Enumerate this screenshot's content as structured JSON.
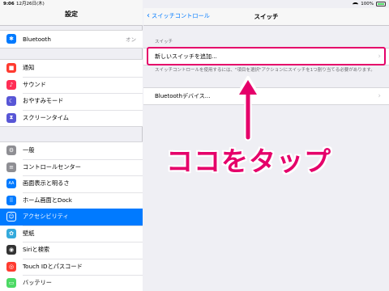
{
  "status": {
    "time": "9:06",
    "date": "12月26日(木)",
    "battery": "100%"
  },
  "sidebar": {
    "title": "設定",
    "bluetooth": {
      "label": "Bluetooth",
      "value": "オン"
    },
    "group2": [
      {
        "label": "通知",
        "icon": "notifications-icon",
        "color": "#ff3b30"
      },
      {
        "label": "サウンド",
        "icon": "sound-icon",
        "color": "#ff2d55"
      },
      {
        "label": "おやすみモード",
        "icon": "moon-icon",
        "color": "#5856d6"
      },
      {
        "label": "スクリーンタイム",
        "icon": "hourglass-icon",
        "color": "#5856d6"
      }
    ],
    "group3": [
      {
        "label": "一般",
        "icon": "gear-icon",
        "color": "#8e8e93"
      },
      {
        "label": "コントロールセンター",
        "icon": "switches-icon",
        "color": "#8e8e93"
      },
      {
        "label": "画面表示と明るさ",
        "icon": "display-icon",
        "color": "#007aff"
      },
      {
        "label": "ホーム画面とDock",
        "icon": "grid-icon",
        "color": "#007aff"
      },
      {
        "label": "アクセシビリティ",
        "icon": "accessibility-icon",
        "color": "#007aff",
        "selected": true
      },
      {
        "label": "壁紙",
        "icon": "wallpaper-icon",
        "color": "#34aadc"
      },
      {
        "label": "Siriと検索",
        "icon": "siri-icon",
        "color": "#333333"
      },
      {
        "label": "Touch IDとパスコード",
        "icon": "fingerprint-icon",
        "color": "#ff3b30"
      },
      {
        "label": "バッテリー",
        "icon": "battery-icon",
        "color": "#4cd964"
      }
    ]
  },
  "content": {
    "back_label": "スイッチコントロール",
    "title": "スイッチ",
    "section_header": "スイッチ",
    "add_switch": "新しいスイッチを追加...",
    "footer": "スイッチコントロールを使用するには、\"項目を選択\"アクションにスイッチを1つ割り当てる必要があります。",
    "bluetooth_devices": "Bluetoothデバイス..."
  },
  "annotation": {
    "text": "ココをタップ",
    "color": "#e5006a"
  }
}
